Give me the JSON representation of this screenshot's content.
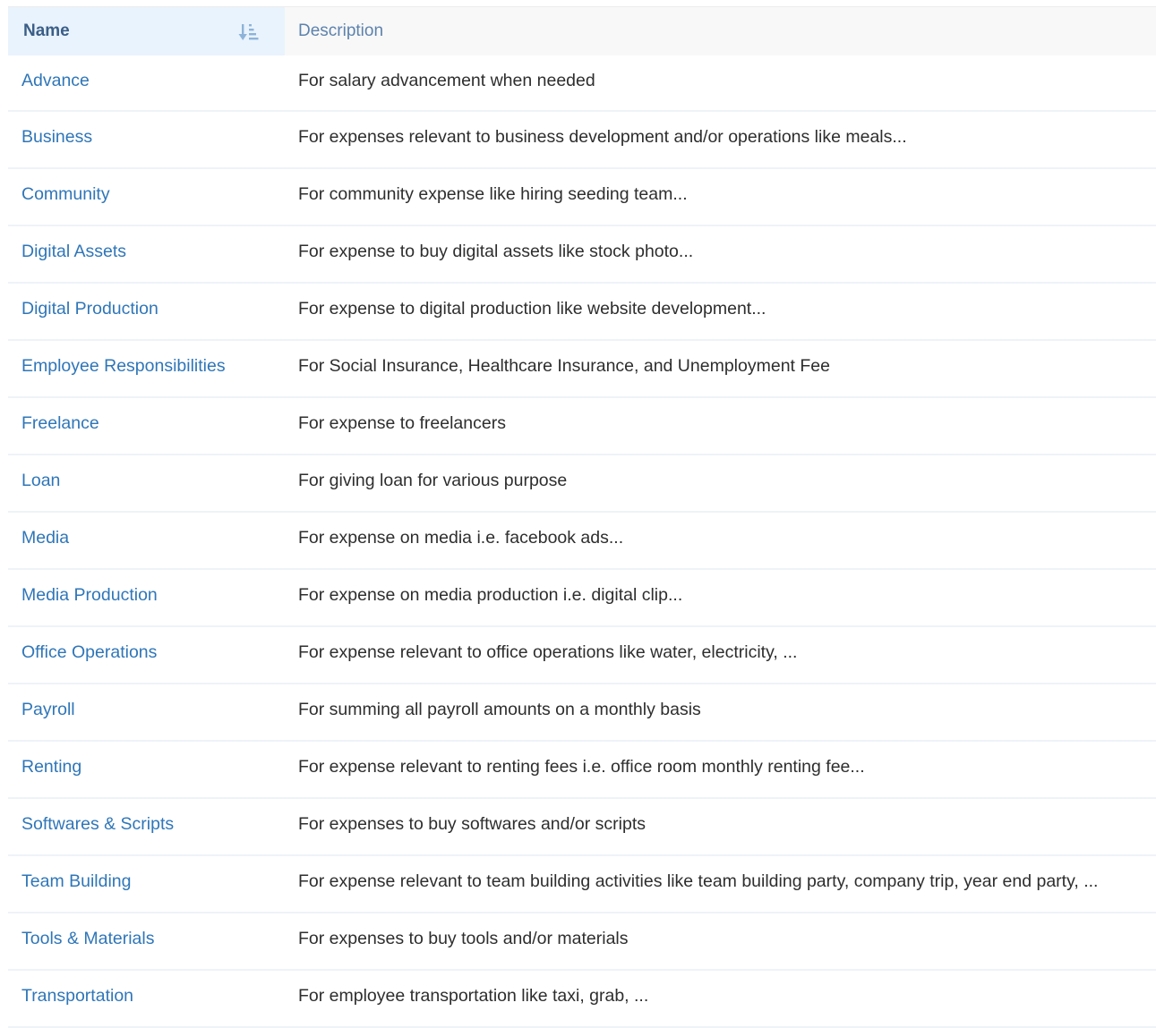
{
  "table": {
    "headers": {
      "name": "Name",
      "description": "Description"
    },
    "sort_icon": "sort-ascending-icon",
    "rows": [
      {
        "name": "Advance",
        "description": "For salary advancement when needed"
      },
      {
        "name": "Business",
        "description": "For expenses relevant to business development and/or operations like meals..."
      },
      {
        "name": "Community",
        "description": "For community expense like hiring seeding team..."
      },
      {
        "name": "Digital Assets",
        "description": "For expense to buy digital assets like stock photo..."
      },
      {
        "name": "Digital Production",
        "description": "For expense to digital production like website development..."
      },
      {
        "name": "Employee Responsibilities",
        "description": "For Social Insurance, Healthcare Insurance, and Unemployment Fee"
      },
      {
        "name": "Freelance",
        "description": "For expense to freelancers"
      },
      {
        "name": "Loan",
        "description": "For giving loan for various purpose"
      },
      {
        "name": "Media",
        "description": "For expense on media i.e. facebook ads..."
      },
      {
        "name": "Media Production",
        "description": "For expense on media production i.e. digital clip..."
      },
      {
        "name": "Office Operations",
        "description": "For expense relevant to office operations like water, electricity, ..."
      },
      {
        "name": "Payroll",
        "description": "For summing all payroll amounts on a monthly basis"
      },
      {
        "name": "Renting",
        "description": "For expense relevant to renting fees i.e. office room monthly renting fee..."
      },
      {
        "name": "Softwares & Scripts",
        "description": "For expenses to buy softwares and/or scripts"
      },
      {
        "name": "Team Building",
        "description": "For expense relevant to team building activities like team building party, company trip, year end party, ..."
      },
      {
        "name": "Tools & Materials",
        "description": "For expenses to buy tools and/or materials"
      },
      {
        "name": "Transportation",
        "description": "For employee transportation like taxi, grab, ..."
      }
    ]
  },
  "colors": {
    "link": "#2f76b8",
    "header_name_bg": "#e9f3fd",
    "header_desc_bg": "#f8f8f8",
    "row_divider": "#eef3f8"
  }
}
